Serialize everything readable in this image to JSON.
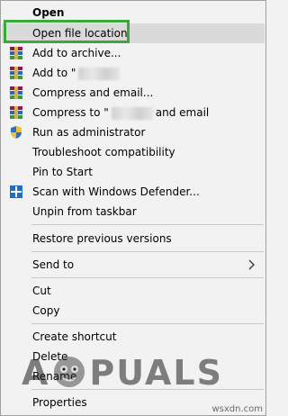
{
  "menu": {
    "items": [
      {
        "label": "Open"
      },
      {
        "label": "Open file location"
      },
      {
        "label": "Add to archive..."
      },
      {
        "label": "Add to \""
      },
      {
        "label": "Compress and email..."
      },
      {
        "label": "Compress to \""
      },
      {
        "label": "and email"
      },
      {
        "label": "Run as administrator"
      },
      {
        "label": "Troubleshoot compatibility"
      },
      {
        "label": "Pin to Start"
      },
      {
        "label": "Scan with Windows Defender..."
      },
      {
        "label": "Unpin from taskbar"
      },
      {
        "label": "Restore previous versions"
      },
      {
        "label": "Send to"
      },
      {
        "label": "Cut"
      },
      {
        "label": "Copy"
      },
      {
        "label": "Create shortcut"
      },
      {
        "label": "Delete"
      },
      {
        "label": "Rename"
      },
      {
        "label": "Properties"
      }
    ]
  },
  "watermark": {
    "left": "A",
    "right": "PUALS"
  },
  "site": "wsxdn.com",
  "colors": {
    "highlight_box": "#3aa83a",
    "menu_bg": "#f2f2f2",
    "hover_bg": "#dadada"
  }
}
